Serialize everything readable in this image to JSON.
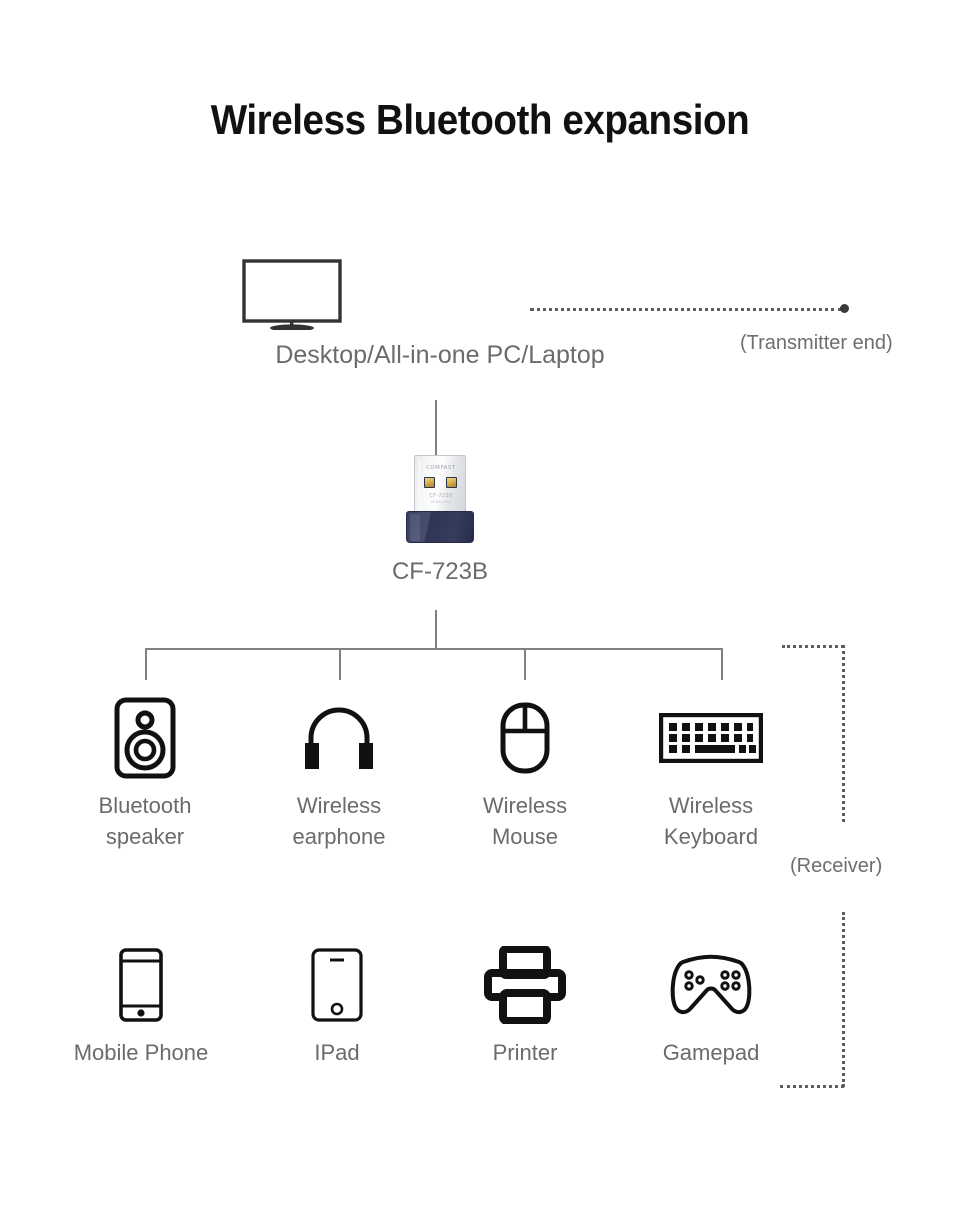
{
  "title": "Wireless Bluetooth expansion",
  "colors": {
    "title": "#111111",
    "label": "#6b6b6b",
    "line": "#808080",
    "dotted": "#5d5d5d",
    "icon": "#111111",
    "dongle_body": "#353c5c",
    "dongle_usb": "#e9eaec",
    "dongle_pin": "#d9b24e"
  },
  "source": {
    "icon": "monitor-icon",
    "label": "Desktop/All-in-one PC/Laptop"
  },
  "adapter": {
    "icon": "usb-dongle-icon",
    "label": "CF-723B",
    "brand_text": "COMFAST",
    "model_text": "CF-723B",
    "sub_text": "WIRELESS"
  },
  "annotations": {
    "transmitter": "(Transmitter end)",
    "receiver": "(Receiver)"
  },
  "devices_row1": [
    {
      "icon": "bluetooth-speaker-icon",
      "label": "Bluetooth\nspeaker"
    },
    {
      "icon": "wireless-earphone-icon",
      "label": "Wireless\nearphone"
    },
    {
      "icon": "wireless-mouse-icon",
      "label": "Wireless\nMouse"
    },
    {
      "icon": "wireless-keyboard-icon",
      "label": "Wireless\nKeyboard"
    }
  ],
  "devices_row2": [
    {
      "icon": "mobile-phone-icon",
      "label": "Mobile Phone"
    },
    {
      "icon": "ipad-icon",
      "label": "IPad"
    },
    {
      "icon": "printer-icon",
      "label": "Printer"
    },
    {
      "icon": "gamepad-icon",
      "label": "Gamepad"
    }
  ]
}
